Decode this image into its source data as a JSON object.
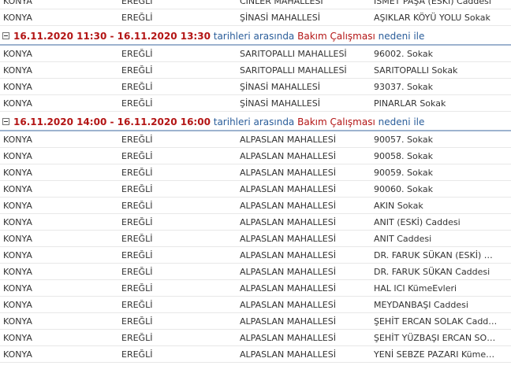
{
  "colors": {
    "date_red": "#b31515",
    "text_blue": "#2a5d9a",
    "divider": "#9db3cf"
  },
  "groups": [
    {
      "header": null,
      "rows": [
        {
          "il": "KONYA",
          "ilce": "EREĞLİ",
          "mahalle": "CİNLER MAHALLESİ",
          "sokak": "İSMET PAŞA (ESKİ) Caddesi"
        },
        {
          "il": "KONYA",
          "ilce": "EREĞLİ",
          "mahalle": "ŞİNASİ MAHALLESİ",
          "sokak": "AŞIKLAR KÖYÜ YOLU Sokak"
        }
      ]
    },
    {
      "header": {
        "icon": "collapse-minus-icon",
        "dates": "16.11.2020 11:30 - 16.11.2020 13:30",
        "between": "tarihleri arasında",
        "reason": "Bakım Çalışması",
        "suffix": "nedeni ile"
      },
      "rows": [
        {
          "il": "KONYA",
          "ilce": "EREĞLİ",
          "mahalle": "SARITOPALLI MAHALLESİ",
          "sokak": "96002. Sokak"
        },
        {
          "il": "KONYA",
          "ilce": "EREĞLİ",
          "mahalle": "SARITOPALLI MAHALLESİ",
          "sokak": "SARITOPALLI Sokak"
        },
        {
          "il": "KONYA",
          "ilce": "EREĞLİ",
          "mahalle": "ŞİNASİ MAHALLESİ",
          "sokak": "93037. Sokak"
        },
        {
          "il": "KONYA",
          "ilce": "EREĞLİ",
          "mahalle": "ŞİNASİ MAHALLESİ",
          "sokak": "PINARLAR Sokak"
        }
      ]
    },
    {
      "header": {
        "icon": "collapse-minus-icon",
        "dates": "16.11.2020 14:00 - 16.11.2020 16:00",
        "between": "tarihleri arasında",
        "reason": "Bakım Çalışması",
        "suffix": "nedeni ile"
      },
      "rows": [
        {
          "il": "KONYA",
          "ilce": "EREĞLİ",
          "mahalle": "ALPASLAN MAHALLESİ",
          "sokak": "90057. Sokak"
        },
        {
          "il": "KONYA",
          "ilce": "EREĞLİ",
          "mahalle": "ALPASLAN MAHALLESİ",
          "sokak": "90058. Sokak"
        },
        {
          "il": "KONYA",
          "ilce": "EREĞLİ",
          "mahalle": "ALPASLAN MAHALLESİ",
          "sokak": "90059. Sokak"
        },
        {
          "il": "KONYA",
          "ilce": "EREĞLİ",
          "mahalle": "ALPASLAN MAHALLESİ",
          "sokak": "90060. Sokak"
        },
        {
          "il": "KONYA",
          "ilce": "EREĞLİ",
          "mahalle": "ALPASLAN MAHALLESİ",
          "sokak": "AKIN Sokak"
        },
        {
          "il": "KONYA",
          "ilce": "EREĞLİ",
          "mahalle": "ALPASLAN MAHALLESİ",
          "sokak": "ANIT (ESKİ) Caddesi"
        },
        {
          "il": "KONYA",
          "ilce": "EREĞLİ",
          "mahalle": "ALPASLAN MAHALLESİ",
          "sokak": "ANIT Caddesi"
        },
        {
          "il": "KONYA",
          "ilce": "EREĞLİ",
          "mahalle": "ALPASLAN MAHALLESİ",
          "sokak": "DR. FARUK SÜKAN (ESKİ) Cad..."
        },
        {
          "il": "KONYA",
          "ilce": "EREĞLİ",
          "mahalle": "ALPASLAN MAHALLESİ",
          "sokak": "DR. FARUK SÜKAN Caddesi"
        },
        {
          "il": "KONYA",
          "ilce": "EREĞLİ",
          "mahalle": "ALPASLAN MAHALLESİ",
          "sokak": "HAL ICI KümeEvleri"
        },
        {
          "il": "KONYA",
          "ilce": "EREĞLİ",
          "mahalle": "ALPASLAN MAHALLESİ",
          "sokak": "MEYDANBAŞI Caddesi"
        },
        {
          "il": "KONYA",
          "ilce": "EREĞLİ",
          "mahalle": "ALPASLAN MAHALLESİ",
          "sokak": "ŞEHİT ERCAN SOLAK Caddesi"
        },
        {
          "il": "KONYA",
          "ilce": "EREĞLİ",
          "mahalle": "ALPASLAN MAHALLESİ",
          "sokak": "ŞEHİT YÜZBAŞI ERCAN SOLA..."
        },
        {
          "il": "KONYA",
          "ilce": "EREĞLİ",
          "mahalle": "ALPASLAN MAHALLESİ",
          "sokak": "YENİ SEBZE PAZARI KümeEvleri"
        }
      ]
    }
  ]
}
